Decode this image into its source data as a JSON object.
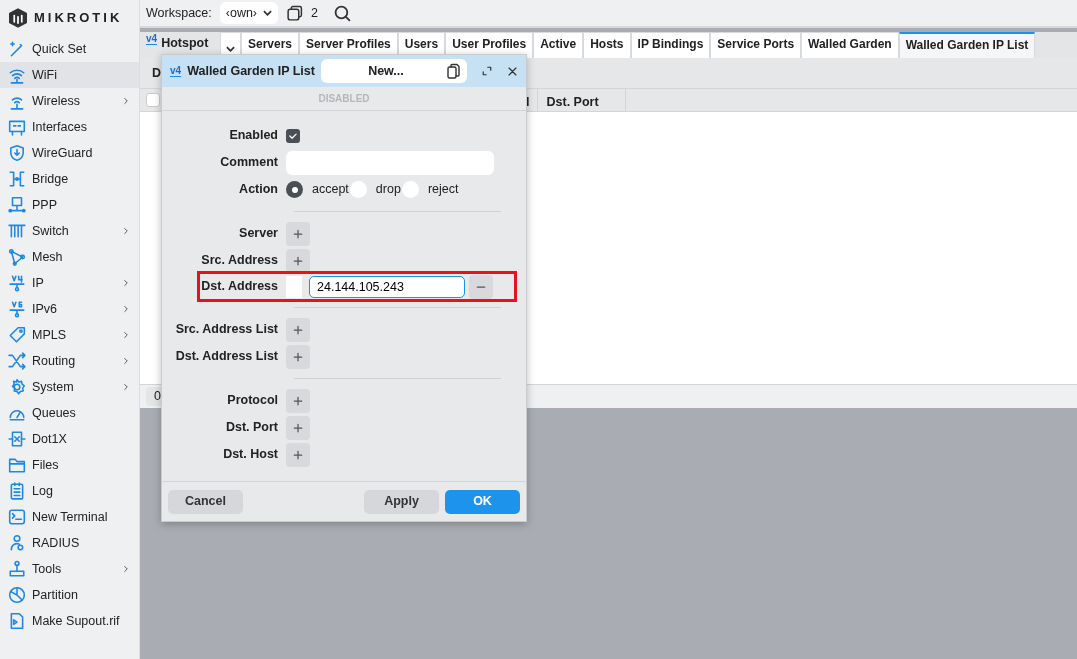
{
  "logo": {
    "text": "MIKROTIK"
  },
  "sidebar": {
    "items": [
      {
        "label": "Quick Set",
        "selected": false,
        "submenu": false
      },
      {
        "label": "WiFi",
        "selected": true,
        "submenu": false
      },
      {
        "label": "Wireless",
        "selected": false,
        "submenu": true
      },
      {
        "label": "Interfaces",
        "selected": false,
        "submenu": false
      },
      {
        "label": "WireGuard",
        "selected": false,
        "submenu": false
      },
      {
        "label": "Bridge",
        "selected": false,
        "submenu": false
      },
      {
        "label": "PPP",
        "selected": false,
        "submenu": false
      },
      {
        "label": "Switch",
        "selected": false,
        "submenu": true
      },
      {
        "label": "Mesh",
        "selected": false,
        "submenu": false
      },
      {
        "label": "IP",
        "selected": false,
        "submenu": true
      },
      {
        "label": "IPv6",
        "selected": false,
        "submenu": true
      },
      {
        "label": "MPLS",
        "selected": false,
        "submenu": true
      },
      {
        "label": "Routing",
        "selected": false,
        "submenu": true
      },
      {
        "label": "System",
        "selected": false,
        "submenu": true
      },
      {
        "label": "Queues",
        "selected": false,
        "submenu": false
      },
      {
        "label": "Dot1X",
        "selected": false,
        "submenu": false
      },
      {
        "label": "Files",
        "selected": false,
        "submenu": false
      },
      {
        "label": "Log",
        "selected": false,
        "submenu": false
      },
      {
        "label": "New Terminal",
        "selected": false,
        "submenu": false
      },
      {
        "label": "RADIUS",
        "selected": false,
        "submenu": false
      },
      {
        "label": "Tools",
        "selected": false,
        "submenu": true
      },
      {
        "label": "Partition",
        "selected": false,
        "submenu": false
      },
      {
        "label": "Make Supout.rif",
        "selected": false,
        "submenu": false
      }
    ]
  },
  "topbar": {
    "workspace_label": "Workspace:",
    "workspace_value": "‹own›",
    "windows_count": "2"
  },
  "section": {
    "title": "Hotspot",
    "badge": "v4"
  },
  "tabs": [
    {
      "label": "Servers",
      "selected": false
    },
    {
      "label": "Server Profiles",
      "selected": false
    },
    {
      "label": "Users",
      "selected": false
    },
    {
      "label": "User Profiles",
      "selected": false
    },
    {
      "label": "Active",
      "selected": false
    },
    {
      "label": "Hosts",
      "selected": false
    },
    {
      "label": "IP Bindings",
      "selected": false
    },
    {
      "label": "Service Ports",
      "selected": false
    },
    {
      "label": "Walled Garden",
      "selected": false
    },
    {
      "label": "Walled Garden IP List",
      "selected": true
    }
  ],
  "toolbar": {
    "button": "D"
  },
  "table": {
    "select_all_checked": false,
    "columns": [
      "l",
      "Dst. Port"
    ]
  },
  "footer": {
    "count": "0"
  },
  "dialog": {
    "badge": "v4",
    "title": "Walled Garden IP List",
    "name": "New...",
    "status": "DISABLED",
    "fields": [
      {
        "kind": "checkbox",
        "label": "Enabled",
        "checked": true
      },
      {
        "kind": "text",
        "label": "Comment"
      },
      {
        "kind": "radio",
        "label": "Action",
        "options": [
          {
            "label": "accept",
            "selected": true
          },
          {
            "label": "drop",
            "selected": false
          },
          {
            "label": "reject",
            "selected": false
          }
        ]
      },
      {
        "kind": "separator"
      },
      {
        "kind": "add",
        "label": "Server"
      },
      {
        "kind": "add",
        "label": "Src. Address"
      },
      {
        "kind": "address",
        "label": "Dst. Address",
        "value": "24.144.105.243",
        "highlighted": true
      },
      {
        "kind": "separator"
      },
      {
        "kind": "add",
        "label": "Src. Address List"
      },
      {
        "kind": "add",
        "label": "Dst. Address List"
      },
      {
        "kind": "separator"
      },
      {
        "kind": "add",
        "label": "Protocol"
      },
      {
        "kind": "add",
        "label": "Dst. Port"
      },
      {
        "kind": "add",
        "label": "Dst. Host"
      }
    ],
    "buttons": [
      {
        "label": "Cancel",
        "kind": "secondary"
      },
      {
        "label": "Apply",
        "kind": "secondary"
      },
      {
        "label": "OK",
        "kind": "primary"
      }
    ]
  }
}
